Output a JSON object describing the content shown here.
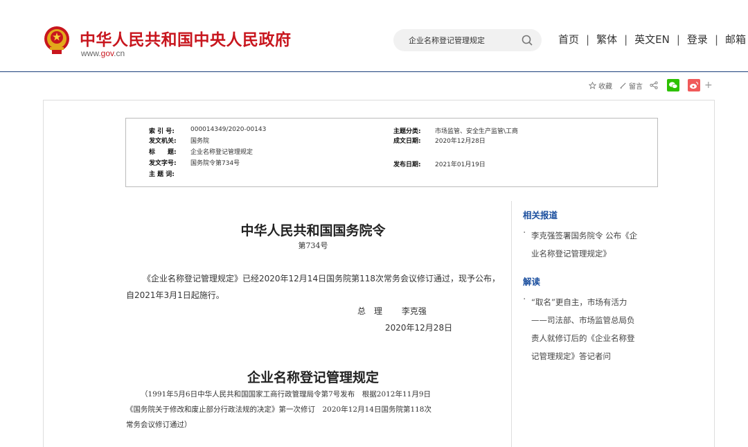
{
  "header": {
    "site_name": "中华人民共和国中央人民政府",
    "site_url_prefix": "www.",
    "site_url_gov": "gov",
    "site_url_suffix": ".cn",
    "search_value": "企业名称登记管理规定",
    "nav": [
      "首页",
      "繁体",
      "英文EN",
      "登录",
      "邮箱"
    ],
    "brand_color": "#c8161e",
    "rule_color": "#1a3e7a"
  },
  "share": {
    "favorite_label": "收藏",
    "message_label": "留言",
    "plus": "+"
  },
  "meta": {
    "index_label": "索 引 号:",
    "index_value": "000014349/2020-00143",
    "category_label": "主题分类:",
    "category_value": "市场监管、安全生产监管\\工商",
    "issuer_label": "发文机关:",
    "issuer_value": "国务院",
    "date_written_label": "成文日期:",
    "date_written_value": "2020年12月28日",
    "title_label": "标　　题:",
    "title_value": "企业名称登记管理规定",
    "doc_no_label": "发文字号:",
    "doc_no_value": "国务院令第734号",
    "publish_label": "发布日期:",
    "publish_value": "2021年01月19日",
    "keywords_label": "主 题 词:"
  },
  "document": {
    "order_title": "中华人民共和国国务院令",
    "order_no": "第734号",
    "announcement": "《企业名称登记管理规定》已经2020年12月14日国务院第118次常务会议修订通过，现予公布，自2021年3月1日起施行。",
    "premier_label": "总　理",
    "premier_name": "李克强",
    "sign_date": "2020年12月28日",
    "regulation_title": "企业名称登记管理规定",
    "history_line1": "（1991年5月6日中华人民共和国国家工商行政管理局令第7号发布　根据2012年11月9日",
    "history_line2": "《国务院关于修改和废止部分行政法规的决定》第一次修订　2020年12月14日国务院第118次",
    "history_line3": "常务会议修订通过）"
  },
  "sidebar": {
    "related_heading": "相关报道",
    "related_item_line1": "李克强签署国务院令 公布《企",
    "related_item_line2": "业名称登记管理规定》",
    "interpret_heading": "解读",
    "interpret_line1": "“取名”更自主，市场有活力",
    "interpret_line2": "——司法部、市场监管总局负",
    "interpret_line3": "责人就修订后的《企业名称登",
    "interpret_line4": "记管理规定》答记者问",
    "link_color": "#1a4e9e"
  }
}
